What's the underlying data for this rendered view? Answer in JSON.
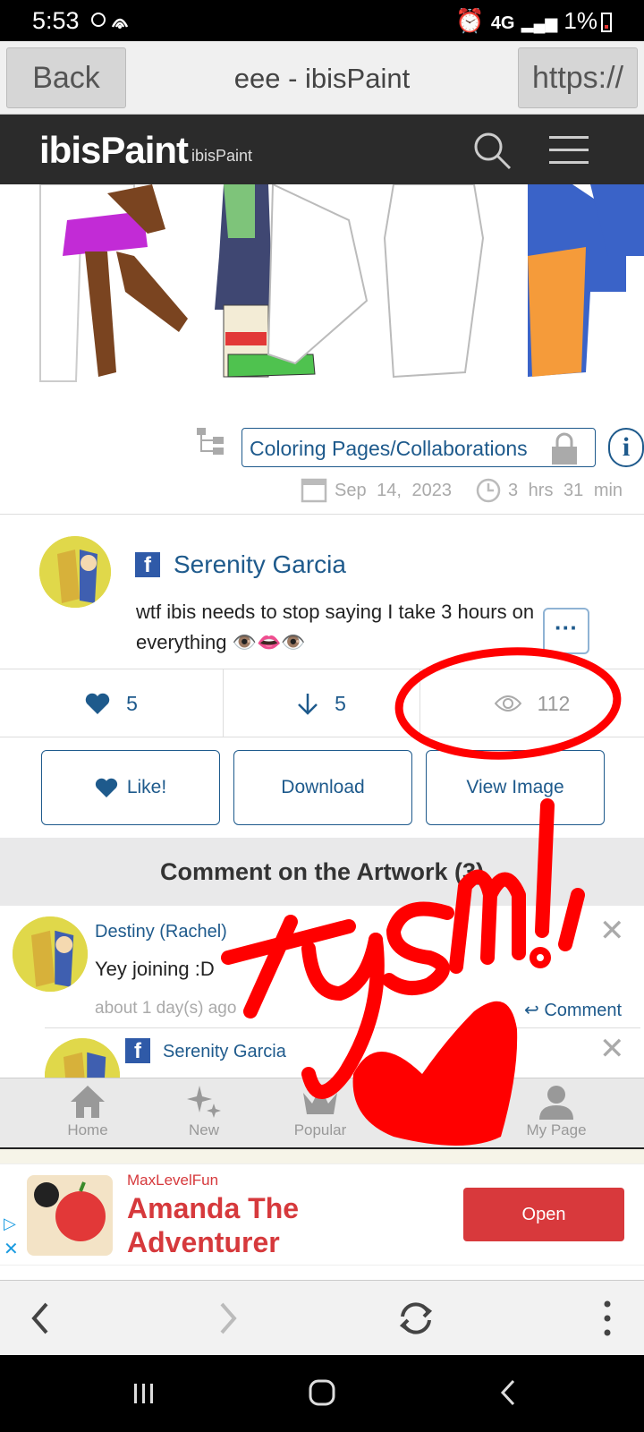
{
  "status_bar": {
    "time": "5:53",
    "network": "4G",
    "battery": "1%"
  },
  "browser": {
    "back_label": "Back",
    "title": "eee - ibisPaint",
    "url_label": "https://"
  },
  "site_header": {
    "logo": "ibisPaint",
    "sub": "ibisPaint"
  },
  "artwork": {
    "tag": "Coloring Pages/Collaborations",
    "date": "Sep 14, 2023",
    "duration": "3 hrs 31 min"
  },
  "author": {
    "name": "Serenity Garcia",
    "description": "wtf ibis needs to stop saying I take 3 hours on everything 👁️👄👁️"
  },
  "stats": {
    "likes": "5",
    "downloads": "5",
    "views": "112"
  },
  "actions": {
    "like": "Like!",
    "download": "Download",
    "view_image": "View Image"
  },
  "comments": {
    "header": "Comment on the Artwork (3)",
    "items": [
      {
        "name": "Destiny (Rachel)",
        "text": "Yey joining :D",
        "time": "about 1 day(s) ago",
        "reply_label": "Comment"
      },
      {
        "name": "Serenity Garcia"
      }
    ]
  },
  "tabbar": {
    "home": "Home",
    "new": "New",
    "popular": "Popular",
    "my_page": "My Page"
  },
  "ad": {
    "source": "MaxLevelFun",
    "title": "Amanda The Adventurer",
    "cta": "Open"
  },
  "annotation": {
    "text": "tysm!,",
    "color": "#ff0000"
  },
  "colors": {
    "accent": "#1e5a8c",
    "header_dark": "#2b2b2b",
    "ad_red": "#d8393c"
  }
}
